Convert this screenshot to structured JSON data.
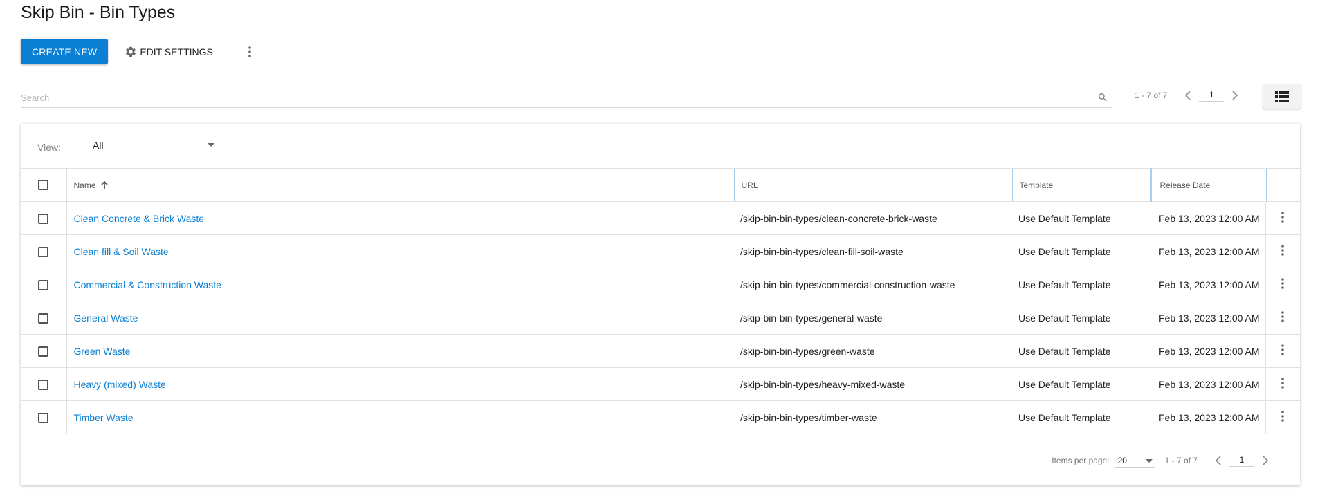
{
  "page": {
    "title": "Skip Bin - Bin Types"
  },
  "toolbar": {
    "create_label": "CREATE NEW",
    "edit_settings_label": "EDIT SETTINGS"
  },
  "search": {
    "placeholder": "Search"
  },
  "top_pager": {
    "range": "1 - 7 of 7",
    "page": "1"
  },
  "view": {
    "label": "View:",
    "selected": "All"
  },
  "table": {
    "columns": {
      "name": "Name",
      "url": "URL",
      "template": "Template",
      "release_date": "Release Date"
    },
    "rows": [
      {
        "name": "Clean Concrete & Brick Waste",
        "url": "/skip-bin-bin-types/clean-concrete-brick-waste",
        "template": "Use Default Template",
        "release_date": "Feb 13, 2023 12:00 AM"
      },
      {
        "name": "Clean fill & Soil Waste",
        "url": "/skip-bin-bin-types/clean-fill-soil-waste",
        "template": "Use Default Template",
        "release_date": "Feb 13, 2023 12:00 AM"
      },
      {
        "name": "Commercial & Construction Waste",
        "url": "/skip-bin-bin-types/commercial-construction-waste",
        "template": "Use Default Template",
        "release_date": "Feb 13, 2023 12:00 AM"
      },
      {
        "name": "General Waste",
        "url": "/skip-bin-bin-types/general-waste",
        "template": "Use Default Template",
        "release_date": "Feb 13, 2023 12:00 AM"
      },
      {
        "name": "Green Waste",
        "url": "/skip-bin-bin-types/green-waste",
        "template": "Use Default Template",
        "release_date": "Feb 13, 2023 12:00 AM"
      },
      {
        "name": "Heavy (mixed) Waste",
        "url": "/skip-bin-bin-types/heavy-mixed-waste",
        "template": "Use Default Template",
        "release_date": "Feb 13, 2023 12:00 AM"
      },
      {
        "name": "Timber Waste",
        "url": "/skip-bin-bin-types/timber-waste",
        "template": "Use Default Template",
        "release_date": "Feb 13, 2023 12:00 AM"
      }
    ]
  },
  "footer": {
    "items_per_page_label": "Items per page:",
    "items_per_page": "20",
    "range": "1 - 7 of 7",
    "page": "1"
  },
  "icons": {
    "settings": "gear-icon",
    "more": "more-vert-icon",
    "search": "search-icon",
    "prev": "chevron-left-icon",
    "next": "chevron-right-icon",
    "list_view": "list-view-icon",
    "sort": "arrow-up-icon"
  },
  "colors": {
    "accent": "#0a7fd3",
    "link": "#0a7fd3"
  }
}
